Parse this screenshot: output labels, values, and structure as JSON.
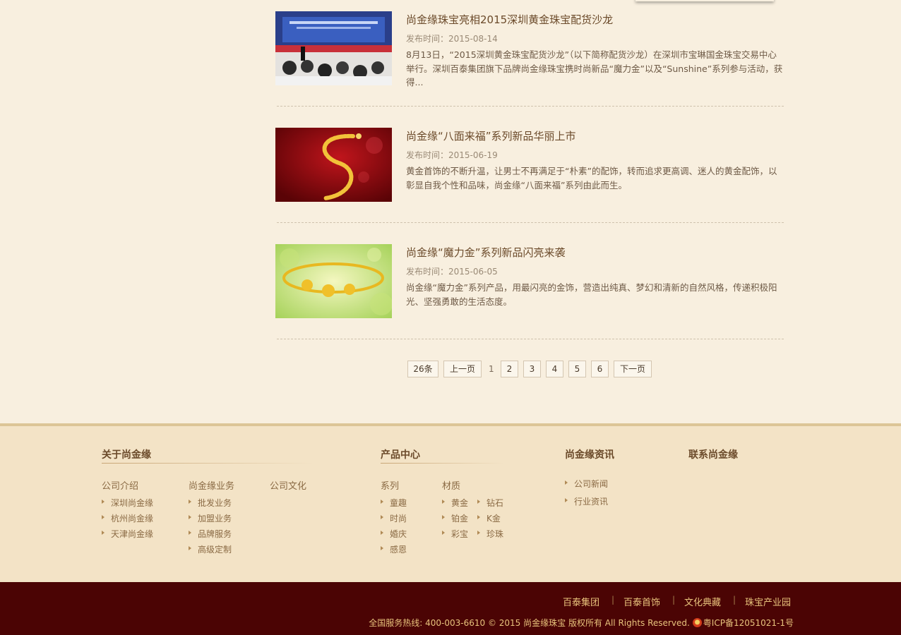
{
  "news": [
    {
      "title": "尚金缘珠宝亮相2015深圳黄金珠宝配货沙龙",
      "date": "发布时间：2015-08-14",
      "summary": "8月13日，“2015深圳黄金珠宝配货沙龙”（以下简称配货沙龙）在深圳市宝琳国金珠宝交易中心举行。深圳百泰集团旗下品牌尚金缘珠宝携时尚新品“魔力金”以及“Sunshine”系列参与活动，获得..."
    },
    {
      "title": "尚金缘“八面来福”系列新品华丽上市",
      "date": "发布时间：2015-06-19",
      "summary": "黄金首饰的不断升温，让男士不再满足于“朴素”的配饰，转而追求更高调、迷人的黄金配饰，以彰显自我个性和品味，尚金缘“八面来福”系列由此而生。"
    },
    {
      "title": "尚金缘“魔力金”系列新品闪亮来袭",
      "date": "发布时间：2015-06-05",
      "summary": "尚金缘“魔力金”系列产品，用最闪亮的金饰，营造出纯真、梦幻和清新的自然风格，传递积极阳光、坚强勇敢的生活态度。"
    }
  ],
  "pagination": {
    "total": "26条",
    "prev": "上一页",
    "current": "1",
    "pages": [
      "2",
      "3",
      "4",
      "5",
      "6"
    ],
    "next": "下一页"
  },
  "footer": {
    "about": {
      "title": "关于尚金缘",
      "intro": {
        "label": "公司介绍",
        "links": [
          "深圳尚金缘",
          "杭州尚金缘",
          "天津尚金缘"
        ]
      },
      "business": {
        "label": "尚金缘业务",
        "links": [
          "批发业务",
          "加盟业务",
          "品牌服务",
          "高级定制"
        ]
      },
      "culture": {
        "label": "公司文化"
      }
    },
    "products": {
      "title": "产品中心",
      "series": {
        "label": "系列",
        "links": [
          "童趣",
          "时尚",
          "婚庆",
          "感恩"
        ]
      },
      "material": {
        "label": "材质",
        "col1": [
          "黄金",
          "铂金",
          "彩宝"
        ],
        "col2": [
          "钻石",
          "K金",
          "珍珠"
        ]
      }
    },
    "news": {
      "title": "尚金缘资讯",
      "links": [
        "公司新闻",
        "行业资讯"
      ]
    },
    "contact": {
      "title": "联系尚金缘"
    },
    "bottom_links": [
      "百泰集团",
      "百泰首饰",
      "文化典藏",
      "珠宝产业园"
    ],
    "separator": "|",
    "copyright": "全国服务热线: 400-003-6610 © 2015 尚金缘珠宝 版权所有 All Rights Reserved.",
    "icp": "粤ICP备12051021-1号"
  },
  "colors": {
    "background": "#f8efdf",
    "footer_top": "#f3e3c6",
    "footer_bottom": "#4b0404",
    "accent_gold": "#e8c37c"
  }
}
